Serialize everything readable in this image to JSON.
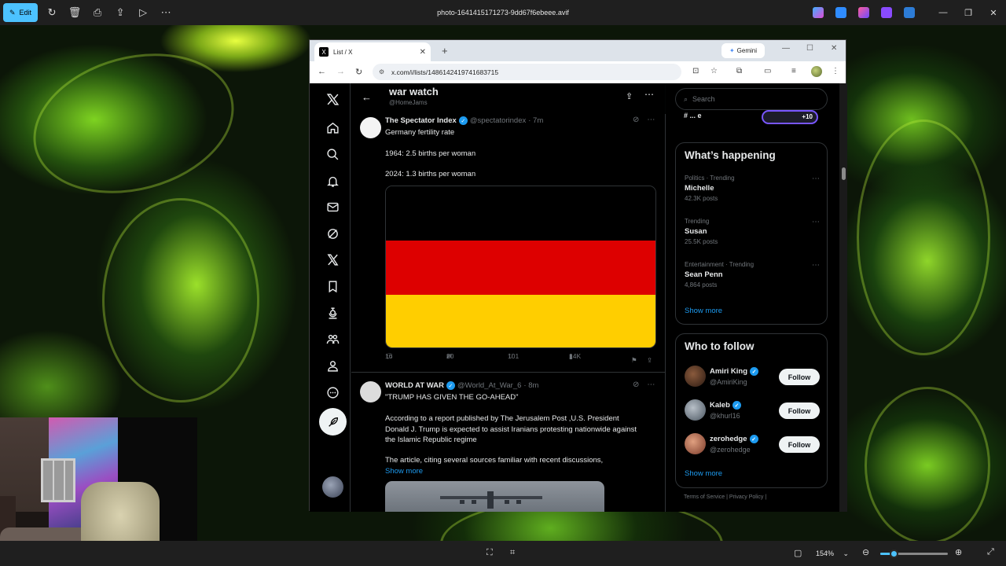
{
  "viewer": {
    "edit_label": "Edit",
    "file_name": "photo-1641415171273-9dd67f6ebeee.avif",
    "zoom_value": "154%",
    "zoom_fraction": 0.2
  },
  "browser": {
    "tab_title": "List / X",
    "tab_favicon": "X",
    "gemini_label": "Gemini",
    "url": "x.com/i/lists/1486142419741683715"
  },
  "list": {
    "title": "war watch",
    "owner": "@HomeJams"
  },
  "tweets": [
    {
      "name": "The Spectator Index",
      "handle": "@spectatorindex",
      "time": "· 7m",
      "lines": [
        "Germany fertility rate",
        "1964: 2.5 births per woman",
        "2024: 1.3 births per woman"
      ],
      "replies": "16",
      "reposts": "20",
      "likes": "101",
      "views": "14K",
      "flag_colors": [
        "#000000",
        "#dd0000",
        "#ffce00"
      ]
    },
    {
      "name": "WORLD AT WAR",
      "handle": "@World_At_War_6",
      "time": "· 8m",
      "headline": "\"TRUMP HAS GIVEN THE GO-AHEAD\"",
      "para1": "According to a report published by The Jerusalem Post ,U.S. President Donald J. Trump is expected to assist Iranians protesting nationwide against the Islamic Republic regime",
      "para2": "The article, citing several sources familiar with recent discussions,",
      "show_more": "Show more"
    }
  ],
  "sidebar": {
    "search_placeholder": "Search",
    "peek_text": "# ... e",
    "peek_count": "+10",
    "whats_happening": "What’s happening",
    "trends": [
      {
        "meta": "Politics · Trending",
        "name": "Michelle",
        "count": "42.3K posts"
      },
      {
        "meta": "Trending",
        "name": "Susan",
        "count": "25.5K posts"
      },
      {
        "meta": "Entertainment · Trending",
        "name": "Sean Penn",
        "count": "4,864 posts"
      }
    ],
    "show_more": "Show more",
    "who_to_follow": "Who to follow",
    "follow_suggestions": [
      {
        "name": "Amiri King",
        "handle": "@AmiriKing",
        "button": "Follow"
      },
      {
        "name": "Kaleb",
        "handle": "@khurl16",
        "button": "Follow"
      },
      {
        "name": "zerohedge",
        "handle": "@zerohedge",
        "button": "Follow"
      }
    ],
    "show_more_2": "Show more",
    "footer": "Terms of Service  |  Privacy Policy  |"
  },
  "colors": {
    "accent": "#1d9bf0",
    "viewer_accent": "#4cc2ff"
  }
}
